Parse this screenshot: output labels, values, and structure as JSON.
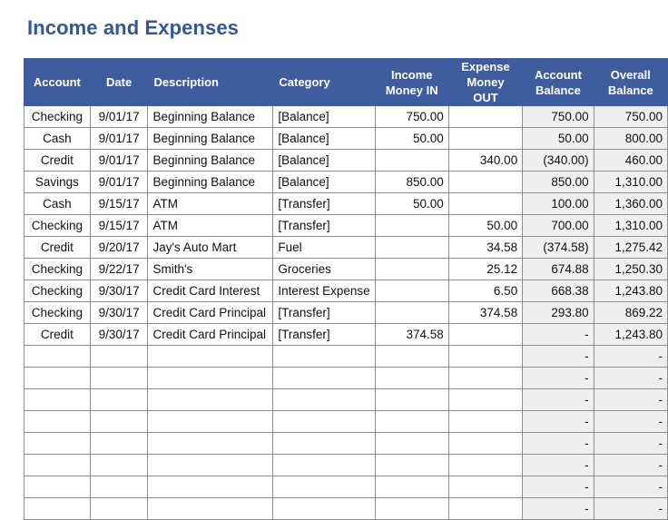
{
  "title": "Income and Expenses",
  "colors": {
    "header_bg": "#3f5d9e",
    "title": "#35569a",
    "negative": "#e0242a",
    "shaded": "#efefef"
  },
  "columns": [
    {
      "key": "account",
      "label_1": "",
      "label_2": "Account"
    },
    {
      "key": "date",
      "label_1": "",
      "label_2": "Date"
    },
    {
      "key": "description",
      "label_1": "",
      "label_2": "Description"
    },
    {
      "key": "category",
      "label_1": "",
      "label_2": "Category"
    },
    {
      "key": "income",
      "label_1": "Income",
      "label_2": "Money IN"
    },
    {
      "key": "expense",
      "label_1": "Expense",
      "label_2": "Money OUT"
    },
    {
      "key": "account_balance",
      "label_1": "Account",
      "label_2": "Balance"
    },
    {
      "key": "overall_balance",
      "label_1": "Overall",
      "label_2": "Balance"
    }
  ],
  "rows": [
    {
      "account": "Checking",
      "date": "9/01/17",
      "description": "Beginning Balance",
      "category": "[Balance]",
      "income": "750.00",
      "expense": "",
      "account_balance": "750.00",
      "overall_balance": "750.00",
      "negative": false
    },
    {
      "account": "Cash",
      "date": "9/01/17",
      "description": "Beginning Balance",
      "category": "[Balance]",
      "income": "50.00",
      "expense": "",
      "account_balance": "50.00",
      "overall_balance": "800.00",
      "negative": false
    },
    {
      "account": "Credit",
      "date": "9/01/17",
      "description": "Beginning Balance",
      "category": "[Balance]",
      "income": "",
      "expense": "340.00",
      "account_balance": "(340.00)",
      "overall_balance": "460.00",
      "negative": true
    },
    {
      "account": "Savings",
      "date": "9/01/17",
      "description": "Beginning Balance",
      "category": "[Balance]",
      "income": "850.00",
      "expense": "",
      "account_balance": "850.00",
      "overall_balance": "1,310.00",
      "negative": false
    },
    {
      "account": "Cash",
      "date": "9/15/17",
      "description": "ATM",
      "category": "[Transfer]",
      "income": "50.00",
      "expense": "",
      "account_balance": "100.00",
      "overall_balance": "1,360.00",
      "negative": false
    },
    {
      "account": "Checking",
      "date": "9/15/17",
      "description": "ATM",
      "category": "[Transfer]",
      "income": "",
      "expense": "50.00",
      "account_balance": "700.00",
      "overall_balance": "1,310.00",
      "negative": false
    },
    {
      "account": "Credit",
      "date": "9/20/17",
      "description": "Jay's Auto Mart",
      "category": "Fuel",
      "income": "",
      "expense": "34.58",
      "account_balance": "(374.58)",
      "overall_balance": "1,275.42",
      "negative": true
    },
    {
      "account": "Checking",
      "date": "9/22/17",
      "description": "Smith's",
      "category": "Groceries",
      "income": "",
      "expense": "25.12",
      "account_balance": "674.88",
      "overall_balance": "1,250.30",
      "negative": false
    },
    {
      "account": "Checking",
      "date": "9/30/17",
      "description": "Credit Card Interest",
      "category": "Interest Expense",
      "income": "",
      "expense": "6.50",
      "account_balance": "668.38",
      "overall_balance": "1,243.80",
      "negative": false,
      "small_category": true
    },
    {
      "account": "Checking",
      "date": "9/30/17",
      "description": "Credit Card Principal",
      "category": "[Transfer]",
      "income": "",
      "expense": "374.58",
      "account_balance": "293.80",
      "overall_balance": "869.22",
      "negative": false
    },
    {
      "account": "Credit",
      "date": "9/30/17",
      "description": "Credit Card Principal",
      "category": "[Transfer]",
      "income": "374.58",
      "expense": "",
      "account_balance": "-",
      "overall_balance": "1,243.80",
      "negative": false,
      "dash": true
    }
  ],
  "empty_rows": 8,
  "empty_placeholder": "-"
}
